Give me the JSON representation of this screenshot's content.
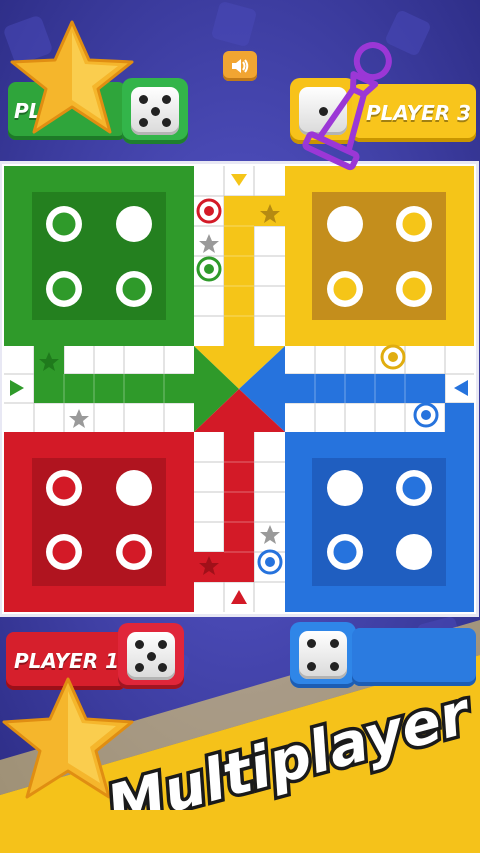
{
  "game": {
    "players": [
      {
        "name": "PLA",
        "color": "#3aa02d",
        "dice_value": 5
      },
      {
        "name": "PLAYER 3",
        "color": "#f5c10a",
        "dice_value": 1
      },
      {
        "name": "PLAYER 1",
        "color": "#d4192a",
        "dice_value": 5
      },
      {
        "name": "",
        "color": "#2b7be0",
        "dice_value": 4
      }
    ],
    "banner": "Multiplayer"
  },
  "colors": {
    "green": "#2f9a2a",
    "yellow": "#f5c518",
    "red": "#d31a27",
    "blue": "#2673dd",
    "background": "#3a3a9c",
    "star": "#f5b62c",
    "pawn_purple": "#9b37d6"
  },
  "icons": {
    "sound": "speaker-icon",
    "star": "star-icon",
    "pawn": "pawn-icon"
  }
}
